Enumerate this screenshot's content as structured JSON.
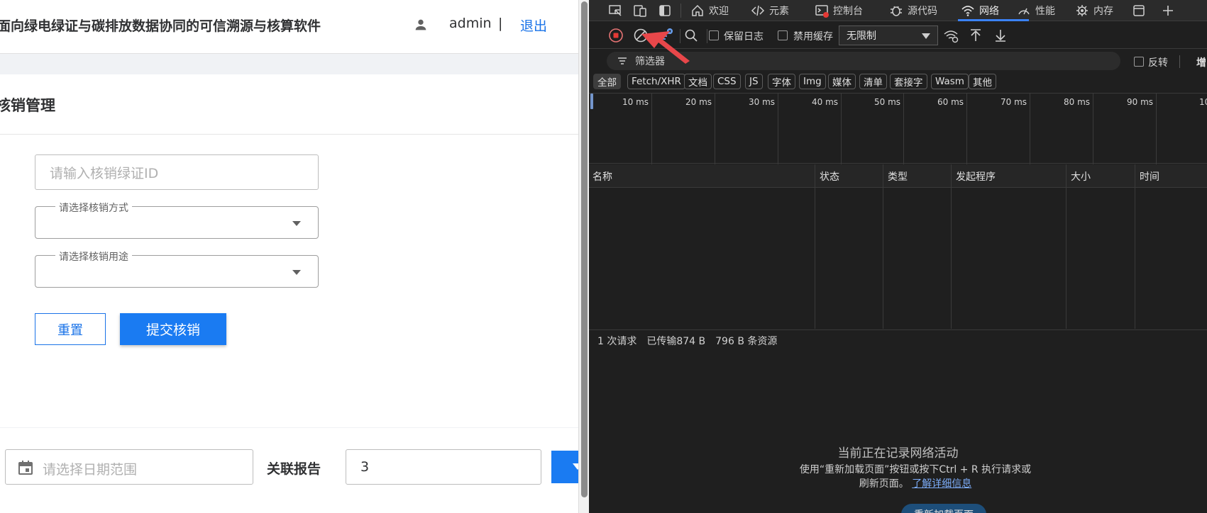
{
  "app": {
    "title": "面向绿电绿证与碳排放数据协同的可信溯源与核算软件",
    "username": "admin",
    "separator": "|",
    "logout": "退出",
    "card_title": "核销管理",
    "form": {
      "cert_id_placeholder": "请输入核销绿证ID",
      "method_label": "请选择核销方式",
      "usage_label": "请选择核销用途",
      "reset_label": "重置",
      "submit_label": "提交核销"
    },
    "query": {
      "date_placeholder": "请选择日期范围",
      "report_label": "关联报告",
      "report_value": "3"
    },
    "colors": {
      "primary": "#1a7bf2",
      "link": "#1a73e8"
    }
  },
  "devtools": {
    "tabs": [
      {
        "label": "欢迎",
        "icon": "home-icon"
      },
      {
        "label": "元素",
        "icon": "code-icon"
      },
      {
        "label": "控制台",
        "icon": "console-icon"
      },
      {
        "label": "源代码",
        "icon": "bug-icon"
      },
      {
        "label": "网络",
        "icon": "wifi-icon",
        "active": true
      },
      {
        "label": "性能",
        "icon": "gauge-icon"
      },
      {
        "label": "内存",
        "icon": "chip-icon"
      }
    ],
    "toolbar": {
      "preserve_log": "保留日志",
      "disable_cache": "禁用缓存",
      "throttle": "无限制"
    },
    "filter": {
      "placeholder": "筛选器",
      "invert": "反转",
      "more": "增"
    },
    "type_filters": [
      "全部",
      "Fetch/XHR",
      "文档",
      "CSS",
      "JS",
      "字体",
      "Img",
      "媒体",
      "清单",
      "套接字",
      "Wasm",
      "其他"
    ],
    "timeline_ticks": [
      "10 ms",
      "20 ms",
      "30 ms",
      "40 ms",
      "50 ms",
      "60 ms",
      "70 ms",
      "80 ms",
      "90 ms",
      "10"
    ],
    "columns": [
      "名称",
      "状态",
      "类型",
      "发起程序",
      "大小",
      "时间"
    ],
    "summary": {
      "requests": "1 次请求",
      "transferred": "已传输874 B",
      "resources": "796 B 条资源"
    },
    "empty": {
      "title": "当前正在记录网络活动",
      "desc": "使用“重新加载页面”按钮或按下Ctrl + R 执行请求或刷新页面。",
      "learn_more": "了解详细信息",
      "reload": "重新加载页面"
    }
  }
}
